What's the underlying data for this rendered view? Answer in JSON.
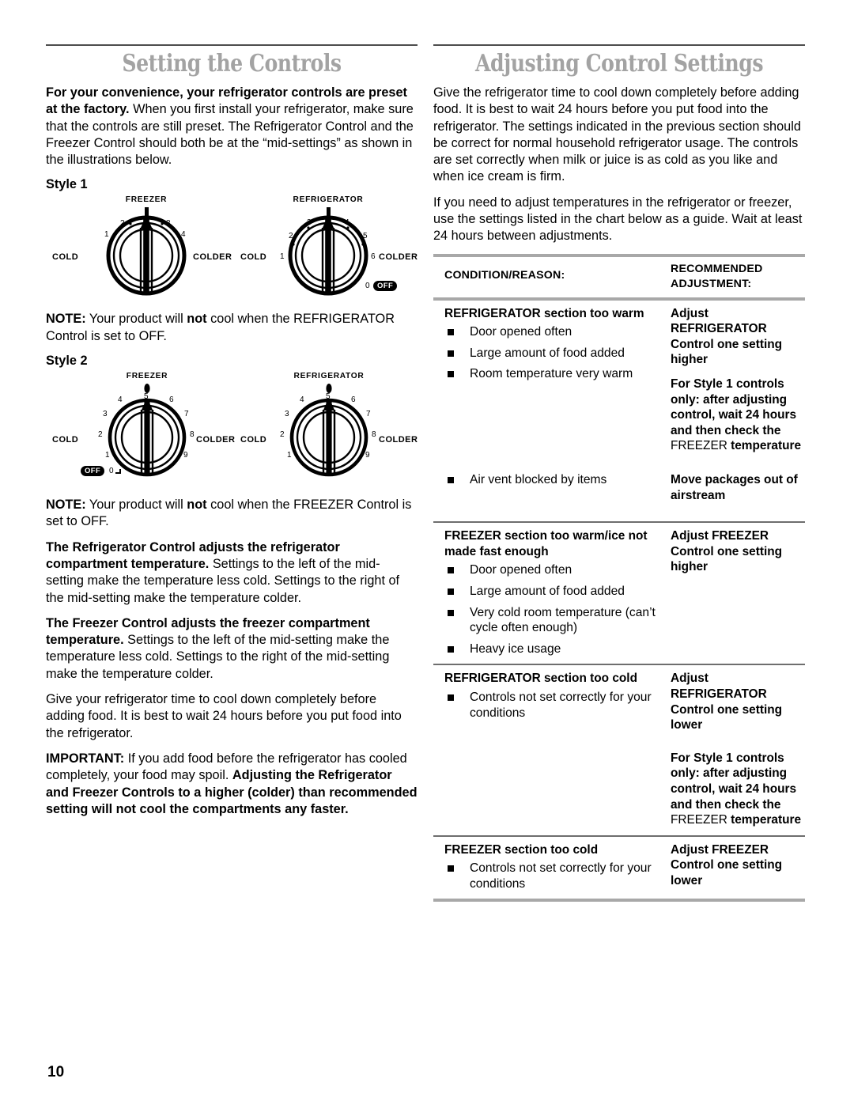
{
  "page": {
    "number": "10"
  },
  "left": {
    "title": "Setting the Controls",
    "intro_bold": "For your convenience, your refrigerator controls are preset at the factory.",
    "intro_rest": " When you first install your refrigerator, make sure that the controls are still preset. The Refrigerator Control and the Freezer Control should both be at the “mid-settings” as shown in the illustrations below.",
    "style1_label": "Style 1",
    "style2_label": "Style 2",
    "note1": {
      "lead": "NOTE:",
      "text_a": " Your product will ",
      "emph": "not",
      "text_b": " cool when the REFRIGERATOR Control is set to OFF."
    },
    "note2": {
      "lead": "NOTE:",
      "text_a": " Your product will ",
      "emph": "not",
      "text_b": " cool when the FREEZER Control is set to OFF."
    },
    "para_fridge_bold": "The Refrigerator Control adjusts the refrigerator compartment temperature.",
    "para_fridge_rest": " Settings to the left of the mid-setting make the temperature less cold. Settings to the right of the mid-setting make the temperature colder.",
    "para_freezer_bold": "The Freezer Control adjusts the freezer compartment temperature.",
    "para_freezer_rest": " Settings to the left of the mid-setting make the temperature less cold. Settings to the right of the mid-setting make the temperature colder.",
    "para_cooldown": "Give your refrigerator time to cool down completely before adding food. It is best to wait 24 hours before you put food into the refrigerator.",
    "important": {
      "lead": "IMPORTANT:",
      "text_a": " If you add food before the refrigerator has cooled completely, your food may spoil. ",
      "emph": "Adjusting the Refrigerator and Freezer Controls to a higher (colder) than recommended setting will not cool the compartments any faster."
    },
    "dials": {
      "cold_label": "COLD",
      "colder_label": "COLDER",
      "off_label": "OFF",
      "style1": {
        "freezer": {
          "caption": "FREEZER",
          "ticks": [
            "1",
            "2",
            "3",
            "4"
          ]
        },
        "refrigerator": {
          "caption": "REFRIGERATOR",
          "ticks": [
            "1",
            "2",
            "3",
            "4",
            "5",
            "6"
          ],
          "zero": "0",
          "off": "OFF"
        }
      },
      "style2": {
        "freezer": {
          "caption": "FREEZER",
          "ticks": [
            "1",
            "2",
            "3",
            "4",
            "5",
            "6",
            "7",
            "8",
            "9"
          ],
          "zero": "0",
          "off": "OFF"
        },
        "refrigerator": {
          "caption": "REFRIGERATOR",
          "ticks": [
            "1",
            "2",
            "3",
            "4",
            "5",
            "6",
            "7",
            "8",
            "9"
          ]
        }
      }
    }
  },
  "right": {
    "title": "Adjusting Control Settings",
    "para1": "Give the refrigerator time to cool down completely before adding food. It is best to wait 24 hours before you put food into the refrigerator. The settings indicated in the previous section should be correct for normal household refrigerator usage. The controls are set correctly when milk or juice is as cold as you like and when ice cream is firm.",
    "para2": "If you need to adjust temperatures in the refrigerator or freezer, use the settings listed in the chart below as a guide. Wait at least 24 hours between adjustments.",
    "table": {
      "header": {
        "col1": "CONDITION/REASON:",
        "col2_line1": "RECOMMENDED",
        "col2_line2": "ADJUSTMENT:"
      },
      "rows": [
        {
          "condition_title": "REFRIGERATOR section too warm",
          "bullets": [
            "Door opened often",
            "Large amount of food added",
            "Room temperature very warm"
          ],
          "adjustments": [
            {
              "text": "Adjust REFRIGERATOR Control one setting higher"
            },
            {
              "text_a": "For Style 1 controls only: after adjusting control, wait 24 hours and then check the ",
              "reg": "FREEZER",
              "text_b": " temperature"
            }
          ]
        },
        {
          "condition_title": "",
          "bullets": [
            "Air vent blocked by items"
          ],
          "adjustments": [
            {
              "text": "Move packages out of airstream"
            }
          ]
        },
        {
          "condition_title": "FREEZER section too warm/ice not made fast enough",
          "bullets": [
            "Door opened often",
            "Large amount of food added",
            "Very cold room temperature (can’t cycle often enough)",
            "Heavy ice usage"
          ],
          "adjustments": [
            {
              "text": "Adjust FREEZER Control one setting higher"
            }
          ]
        },
        {
          "condition_title": "REFRIGERATOR section too cold",
          "bullets": [
            "Controls not set correctly for your conditions"
          ],
          "adjustments": [
            {
              "text": "Adjust REFRIGERATOR Control one setting lower"
            },
            {
              "text_a": "For Style 1 controls only: after adjusting control, wait 24 hours and then check the ",
              "reg": "FREEZER",
              "text_b": " temperature"
            }
          ]
        },
        {
          "condition_title": "FREEZER section too cold",
          "bullets": [
            "Controls not set correctly for your conditions"
          ],
          "adjustments": [
            {
              "text": "Adjust FREEZER Control one setting lower"
            }
          ]
        }
      ]
    }
  }
}
